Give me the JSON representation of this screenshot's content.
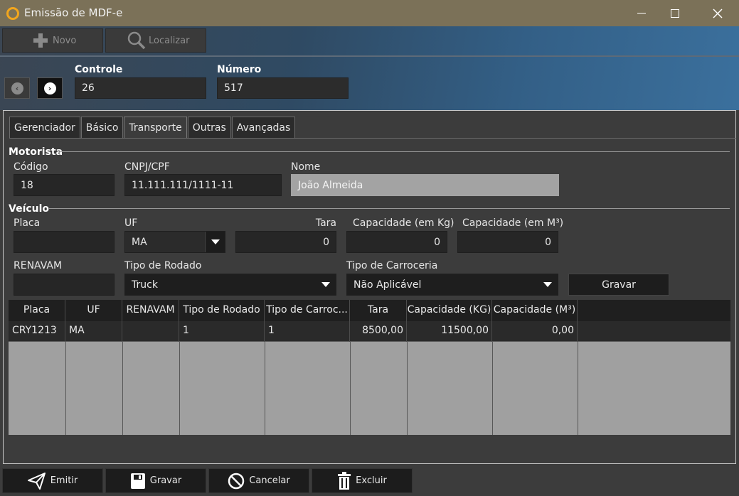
{
  "window": {
    "title": "Emissão de MDF-e"
  },
  "toolbar": {
    "new_label": "Novo",
    "find_label": "Localizar"
  },
  "header": {
    "controle_label": "Controle",
    "controle_value": "26",
    "numero_label": "Número",
    "numero_value": "517"
  },
  "tabs": [
    {
      "label": "Gerenciador"
    },
    {
      "label": "Básico"
    },
    {
      "label": "Transporte"
    },
    {
      "label": "Outras"
    },
    {
      "label": "Avançadas"
    }
  ],
  "motorista": {
    "section_label": "Motorista",
    "codigo_label": "Código",
    "codigo_value": "18",
    "cnpj_label": "CNPJ/CPF",
    "cnpj_value": "11.111.111/1111-11",
    "nome_label": "Nome",
    "nome_value": "João Almeida"
  },
  "veiculo": {
    "section_label": "Veículo",
    "placa_label": "Placa",
    "placa_value": "",
    "uf_label": "UF",
    "uf_value": "MA",
    "tara_label": "Tara",
    "tara_value": "0",
    "cap_kg_label": "Capacidade (em Kg)",
    "cap_kg_value": "0",
    "cap_m3_label": "Capacidade (em M³)",
    "cap_m3_value": "0",
    "renavam_label": "RENAVAM",
    "renavam_value": "",
    "rodado_label": "Tipo de Rodado",
    "rodado_value": "Truck",
    "carroceria_label": "Tipo de Carroceria",
    "carroceria_value": "Não Aplicável",
    "save_label": "Gravar"
  },
  "grid": {
    "columns": [
      "Placa",
      "UF",
      "RENAVAM",
      "Tipo de Rodado",
      "Tipo de Carroc...",
      "Tara",
      "Capacidade (KG)",
      "Capacidade (M³)"
    ],
    "rows": [
      [
        "CRY1213",
        "MA",
        "",
        "1",
        "1",
        "8500,00",
        "11500,00",
        "0,00"
      ]
    ]
  },
  "footer": {
    "emit_label": "Emitir",
    "save_label": "Gravar",
    "cancel_label": "Cancelar",
    "delete_label": "Excluir"
  }
}
